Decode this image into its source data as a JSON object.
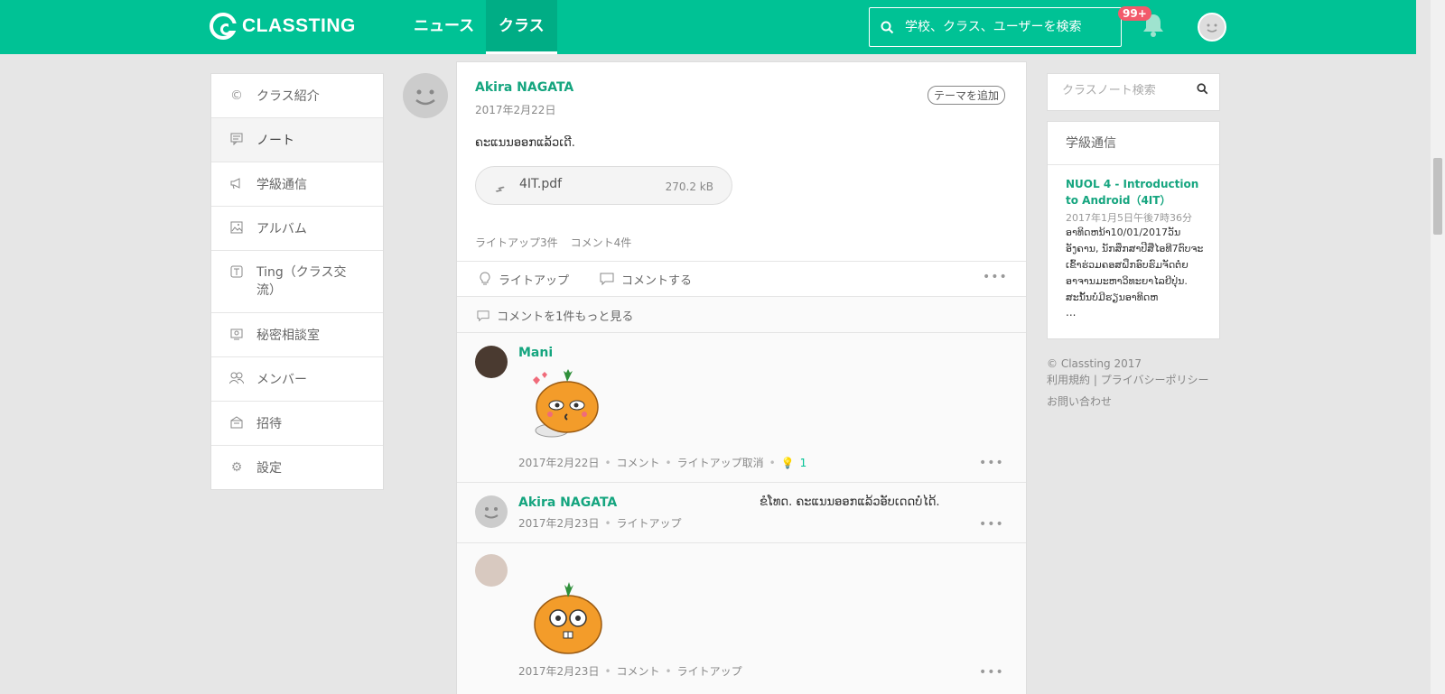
{
  "header": {
    "logo_text": "CLASSTING",
    "nav": [
      {
        "label": "ニュース"
      },
      {
        "label": "クラス"
      }
    ],
    "search_placeholder": "学校、クラス、ユーザーを検索",
    "notification_badge": "99+",
    "colors": {
      "brand": "#00c295",
      "badge": "#f25a6b"
    }
  },
  "sidebar": {
    "items": [
      {
        "label": "クラス紹介",
        "icon": "copyright-icon"
      },
      {
        "label": "ノート",
        "icon": "note-icon"
      },
      {
        "label": "学級通信",
        "icon": "megaphone-icon"
      },
      {
        "label": "アルバム",
        "icon": "image-icon"
      },
      {
        "label": "Ting（クラス交流）",
        "icon": "ting-icon"
      },
      {
        "label": "秘密相談室",
        "icon": "secret-icon"
      },
      {
        "label": "メンバー",
        "icon": "members-icon"
      },
      {
        "label": "招待",
        "icon": "invite-icon"
      },
      {
        "label": "設定",
        "icon": "gear-icon"
      }
    ]
  },
  "post": {
    "author": "Akira NAGATA",
    "date": "2017年2月22日",
    "theme_button": "テーマを追加",
    "body": "ຄະແນນອອກແລ້ວເດີ.",
    "attachment": {
      "name": "4IT.pdf",
      "size": "270.2 kB"
    },
    "likes_count": "ライトアップ3件",
    "comments_count": "コメント4件",
    "actions": {
      "like": "ライトアップ",
      "comment": "コメントする"
    },
    "more_comments": "コメントを1件もっと見る"
  },
  "comments": [
    {
      "author": "Mani",
      "date": "2017年2月22日",
      "meta": [
        "コメント",
        "ライトアップ取消"
      ],
      "likes": "1",
      "sticker": "pumpkin-kiss-sticker"
    },
    {
      "author": "Akira NAGATA",
      "text": "ຂໍໂທດ. ຄະແນນອອກແລ້ວອັບເດດບໍ່ໄດ້.",
      "date": "2017年2月23日",
      "meta": [
        "ライトアップ"
      ]
    },
    {
      "author": "",
      "date": "2017年2月23日",
      "meta": [
        "コメント",
        "ライトアップ"
      ],
      "sticker": "pumpkin-shocked-sticker"
    }
  ],
  "right_panel": {
    "note_search_placeholder": "クラスノート検索",
    "widget_heading": "学級通信",
    "notice": {
      "title": "NUOL 4 - Introduction to Android（4IT）",
      "date": "2017年1月5日午後7時36分",
      "text": "ອາທິດຫນ້າ10/01/2017ວັນອັງຄານ, ນັກສຶກສາປີສີ່ໄອທີ7ຕົບຈະເຂົ້າຮ່ວມຄອສຝຶກອົບຮົມຈັດຕໍ່ຍອາຈານມະຫາວິທະຍາໄລຍີປຸ່ນ. ສະນັ້ນບໍ່ມີຮຽນອາທິດຫ",
      "more": "..."
    },
    "footer": {
      "copyright": "© Classting 2017",
      "links": [
        "利用規約",
        "プライバシーポリシー",
        "お問い合わせ"
      ]
    }
  }
}
